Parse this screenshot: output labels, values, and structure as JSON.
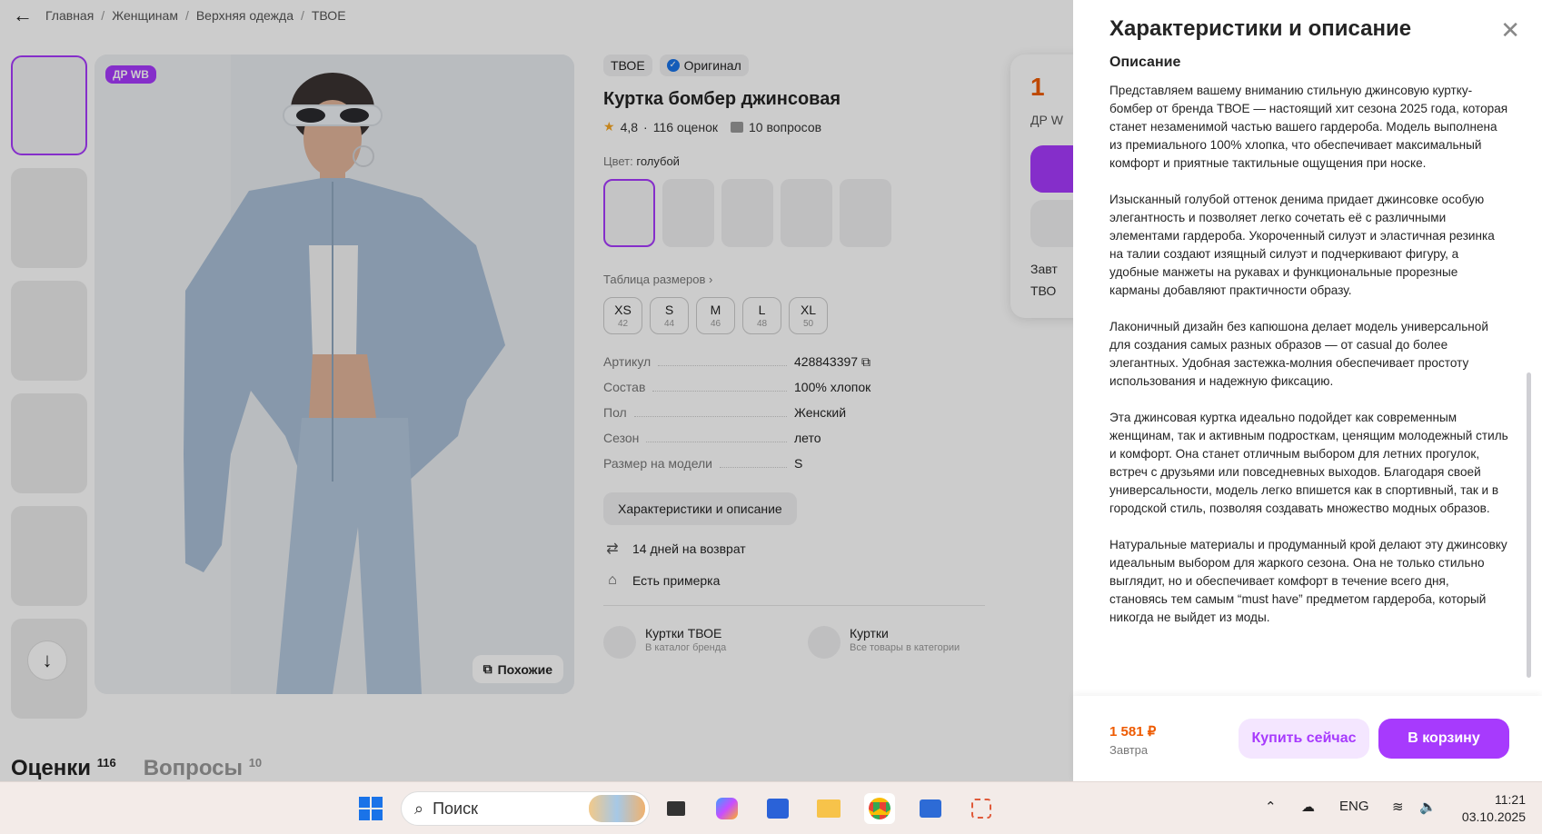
{
  "breadcrumbs": [
    "Главная",
    "Женщинам",
    "Верхняя одежда",
    "ТВОЕ"
  ],
  "photo": {
    "badge": "ДР WB",
    "similar_label": "Похожие"
  },
  "product": {
    "brand": "ТВОЕ",
    "original_label": "Оригинал",
    "title": "Куртка бомбер джинсовая",
    "rating": "4,8",
    "reviews": "116 оценок",
    "questions": "10 вопросов",
    "color_label": "Цвет:",
    "color_value": "голубой",
    "size_table_label": "Таблица размеров",
    "sizes": [
      {
        "label": "XS",
        "ru": "42"
      },
      {
        "label": "S",
        "ru": "44"
      },
      {
        "label": "M",
        "ru": "46"
      },
      {
        "label": "L",
        "ru": "48"
      },
      {
        "label": "XL",
        "ru": "50"
      }
    ],
    "specs": [
      {
        "k": "Артикул",
        "v": "428843397"
      },
      {
        "k": "Состав",
        "v": "100% хлопок"
      },
      {
        "k": "Пол",
        "v": "Женский"
      },
      {
        "k": "Сезон",
        "v": "лето"
      },
      {
        "k": "Размер на модели",
        "v": "S"
      }
    ],
    "char_button": "Характеристики и описание",
    "perks": [
      "14 дней на возврат",
      "Есть примерка"
    ],
    "categories": [
      {
        "title": "Куртки ТВОЕ",
        "sub": "В каталог бренда"
      },
      {
        "title": "Куртки",
        "sub": "Все товары в категории"
      }
    ]
  },
  "buybox": {
    "price": "1",
    "tag": "ДР W",
    "line1": "Завт",
    "line2": "ТВО"
  },
  "tabs": [
    {
      "label": "Оценки",
      "count": "116"
    },
    {
      "label": "Вопросы",
      "count": "10"
    }
  ],
  "drawer": {
    "title": "Характеристики и описание",
    "section": "Описание",
    "paragraphs": [
      "Представляем вашему вниманию стильную джинсовую куртку-бомбер от бренда ТВОЕ — настоящий хит сезона 2025 года, которая станет незаменимой частью вашего гардероба. Модель выполнена из премиального 100% хлопка, что обеспечивает максимальный комфорт и приятные тактильные ощущения при носке.",
      "Изысканный голубой оттенок денима придает джинсовке особую элегантность и позволяет легко сочетать её с различными элементами гардероба. Укороченный силуэт и эластичная резинка на талии создают изящный силуэт и подчеркивают фигуру, а удобные манжеты на рукавах и функциональные прорезные карманы добавляют практичности образу.",
      "Лаконичный дизайн без капюшона делает модель универсальной для создания самых разных образов — от casual до более элегантных. Удобная застежка-молния обеспечивает простоту использования и надежную фиксацию.",
      "Эта джинсовая куртка идеально подойдет как современным женщинам, так и активным подросткам, ценящим молодежный стиль и комфорт. Она станет отличным выбором для летних прогулок, встреч с друзьями или повседневных выходов. Благодаря своей универсальности, модель легко впишется как в спортивный, так и в городской стиль, позволяя создавать множество модных образов.",
      "Натуральные материалы и продуманный крой делают эту джинсовку идеальным выбором для жаркого сезона. Она не только стильно выглядит, но и обеспечивает комфорт в течение всего дня, становясь тем самым “must have” предметом гардероба, который никогда не выйдет из моды."
    ],
    "footer_price": "1 581 ₽",
    "footer_when": "Завтра",
    "buy_now": "Купить сейчас",
    "add_to_cart": "В корзину"
  },
  "taskbar": {
    "search_placeholder": "Поиск",
    "language": "ENG",
    "time": "11:21",
    "date": "03.10.2025"
  },
  "colors": {
    "accent": "#a73afd",
    "price": "#ee5a00"
  }
}
